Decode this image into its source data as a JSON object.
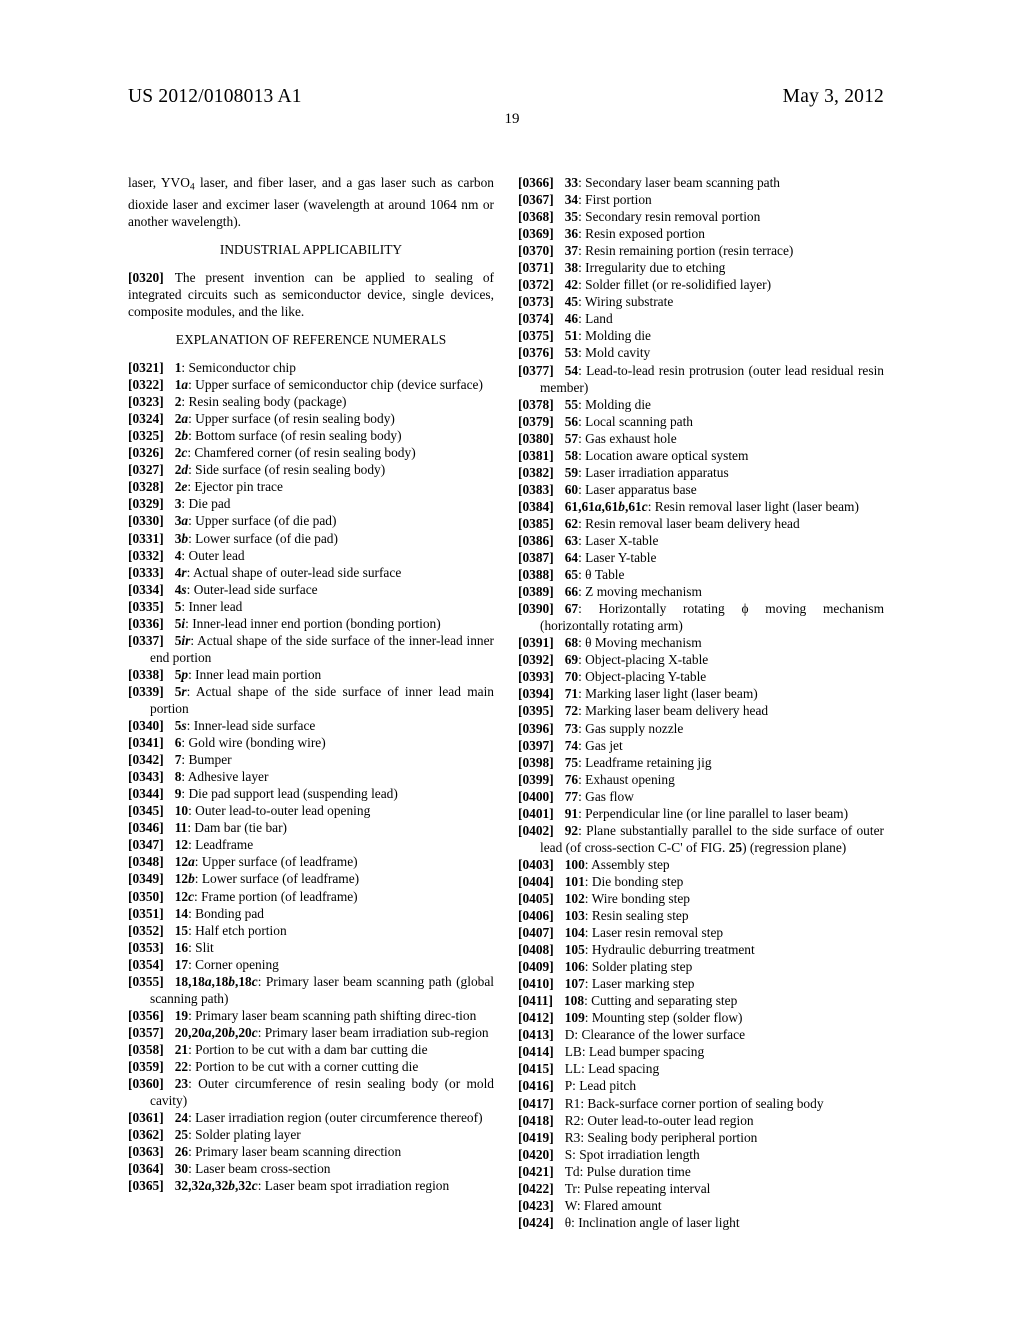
{
  "header": {
    "pub_number": "US 2012/0108013 A1",
    "pub_date": "May 3, 2012",
    "page_number": "19"
  },
  "left_column": {
    "continuation_paragraph": "laser, YVO4 laser, and fiber laser, and a gas laser such as carbon dioxide laser and excimer laser (wavelength at around 1064 nm or another wavelength).",
    "heading_industrial": "INDUSTRIAL APPLICABILITY",
    "para_0320_num": "[0320]",
    "para_0320_text": "The present invention can be applied to sealing of integrated circuits such as semiconductor device, single devices, composite modules, and the like.",
    "heading_explanation": "EXPLANATION OF REFERENCE NUMERALS",
    "entries": [
      {
        "num": "[0321]",
        "label": "1",
        "label_italic": "",
        "text": ": Semiconductor chip"
      },
      {
        "num": "[0322]",
        "label": "1",
        "label_italic": "a",
        "text": ": Upper surface of semiconductor chip (device surface)"
      },
      {
        "num": "[0323]",
        "label": "2",
        "label_italic": "",
        "text": ": Resin sealing body (package)"
      },
      {
        "num": "[0324]",
        "label": "2",
        "label_italic": "a",
        "text": ": Upper surface (of resin sealing body)"
      },
      {
        "num": "[0325]",
        "label": "2",
        "label_italic": "b",
        "text": ": Bottom surface (of resin sealing body)"
      },
      {
        "num": "[0326]",
        "label": "2",
        "label_italic": "c",
        "text": ": Chamfered corner (of resin sealing body)"
      },
      {
        "num": "[0327]",
        "label": "2",
        "label_italic": "d",
        "text": ": Side surface (of resin sealing body)"
      },
      {
        "num": "[0328]",
        "label": "2",
        "label_italic": "e",
        "text": ": Ejector pin trace"
      },
      {
        "num": "[0329]",
        "label": "3",
        "label_italic": "",
        "text": ": Die pad"
      },
      {
        "num": "[0330]",
        "label": "3",
        "label_italic": "a",
        "text": ": Upper surface (of die pad)"
      },
      {
        "num": "[0331]",
        "label": "3",
        "label_italic": "b",
        "text": ": Lower surface (of die pad)"
      },
      {
        "num": "[0332]",
        "label": "4",
        "label_italic": "",
        "text": ": Outer lead"
      },
      {
        "num": "[0333]",
        "label": "4",
        "label_italic": "r",
        "text": ": Actual shape of outer-lead side surface"
      },
      {
        "num": "[0334]",
        "label": "4",
        "label_italic": "s",
        "text": ": Outer-lead side surface"
      },
      {
        "num": "[0335]",
        "label": "5",
        "label_italic": "",
        "text": ": Inner lead"
      },
      {
        "num": "[0336]",
        "label": "5",
        "label_italic": "i",
        "text": ": Inner-lead inner end portion (bonding portion)"
      },
      {
        "num": "[0337]",
        "label": "5",
        "label_italic": "ir",
        "text": ": Actual shape of the side surface of the inner-lead inner end portion"
      },
      {
        "num": "[0338]",
        "label": "5",
        "label_italic": "p",
        "text": ": Inner lead main portion"
      },
      {
        "num": "[0339]",
        "label": "5",
        "label_italic": "r",
        "text": ": Actual shape of the side surface of inner lead main portion"
      },
      {
        "num": "[0340]",
        "label": "5",
        "label_italic": "s",
        "text": ": Inner-lead side surface"
      },
      {
        "num": "[0341]",
        "label": "6",
        "label_italic": "",
        "text": ": Gold wire (bonding wire)"
      },
      {
        "num": "[0342]",
        "label": "7",
        "label_italic": "",
        "text": ": Bumper"
      },
      {
        "num": "[0343]",
        "label": "8",
        "label_italic": "",
        "text": ": Adhesive layer"
      },
      {
        "num": "[0344]",
        "label": "9",
        "label_italic": "",
        "text": ": Die pad support lead (suspending lead)"
      },
      {
        "num": "[0345]",
        "label": "10",
        "label_italic": "",
        "text": ": Outer lead-to-outer lead opening"
      },
      {
        "num": "[0346]",
        "label": "11",
        "label_italic": "",
        "text": ": Dam bar (tie bar)"
      },
      {
        "num": "[0347]",
        "label": "12",
        "label_italic": "",
        "text": ": Leadframe"
      },
      {
        "num": "[0348]",
        "label": "12",
        "label_italic": "a",
        "text": ": Upper surface (of leadframe)"
      },
      {
        "num": "[0349]",
        "label": "12",
        "label_italic": "b",
        "text": ": Lower surface (of leadframe)"
      },
      {
        "num": "[0350]",
        "label": "12",
        "label_italic": "c",
        "text": ": Frame portion (of leadframe)"
      },
      {
        "num": "[0351]",
        "label": "14",
        "label_italic": "",
        "text": ": Bonding pad"
      },
      {
        "num": "[0352]",
        "label": "15",
        "label_italic": "",
        "text": ": Half etch portion"
      },
      {
        "num": "[0353]",
        "label": "16",
        "label_italic": "",
        "text": ": Slit"
      },
      {
        "num": "[0354]",
        "label": "17",
        "label_italic": "",
        "text": ": Corner opening"
      },
      {
        "num": "[0355]",
        "label_multi": "18,18a,18b,18c",
        "text": ": Primary laser beam scanning path (global scanning path)"
      },
      {
        "num": "[0356]",
        "label": "19",
        "label_italic": "",
        "text": ": Primary laser beam scanning path shifting direc-tion"
      },
      {
        "num": "[0357]",
        "label_multi": "20,20a,20b,20c",
        "text": ": Primary laser beam irradiation sub-region"
      },
      {
        "num": "[0358]",
        "label": "21",
        "label_italic": "",
        "text": ": Portion to be cut with a dam bar cutting die"
      },
      {
        "num": "[0359]",
        "label": "22",
        "label_italic": "",
        "text": ": Portion to be cut with a corner cutting die"
      },
      {
        "num": "[0360]",
        "label": "23",
        "label_italic": "",
        "text": ": Outer circumference of resin sealing body (or mold cavity)"
      },
      {
        "num": "[0361]",
        "label": "24",
        "label_italic": "",
        "text": ": Laser irradiation region (outer circumference thereof)"
      },
      {
        "num": "[0362]",
        "label": "25",
        "label_italic": "",
        "text": ": Solder plating layer"
      },
      {
        "num": "[0363]",
        "label": "26",
        "label_italic": "",
        "text": ": Primary laser beam scanning direction"
      },
      {
        "num": "[0364]",
        "label": "30",
        "label_italic": "",
        "text": ": Laser beam cross-section"
      },
      {
        "num": "[0365]",
        "label_multi": "32,32a,32b,32c",
        "text": ": Laser beam spot irradiation region"
      }
    ]
  },
  "right_column": {
    "entries": [
      {
        "num": "[0366]",
        "label": "33",
        "label_italic": "",
        "text": ": Secondary laser beam scanning path"
      },
      {
        "num": "[0367]",
        "label": "34",
        "label_italic": "",
        "text": ": First portion"
      },
      {
        "num": "[0368]",
        "label": "35",
        "label_italic": "",
        "text": ": Secondary resin removal portion"
      },
      {
        "num": "[0369]",
        "label": "36",
        "label_italic": "",
        "text": ": Resin exposed portion"
      },
      {
        "num": "[0370]",
        "label": "37",
        "label_italic": "",
        "text": ": Resin remaining portion (resin terrace)"
      },
      {
        "num": "[0371]",
        "label": "38",
        "label_italic": "",
        "text": ": Irregularity due to etching"
      },
      {
        "num": "[0372]",
        "label": "42",
        "label_italic": "",
        "text": ": Solder fillet (or re-solidified layer)"
      },
      {
        "num": "[0373]",
        "label": "45",
        "label_italic": "",
        "text": ": Wiring substrate"
      },
      {
        "num": "[0374]",
        "label": "46",
        "label_italic": "",
        "text": ": Land"
      },
      {
        "num": "[0375]",
        "label": "51",
        "label_italic": "",
        "text": ": Molding die"
      },
      {
        "num": "[0376]",
        "label": "53",
        "label_italic": "",
        "text": ": Mold cavity"
      },
      {
        "num": "[0377]",
        "label": "54",
        "label_italic": "",
        "text": ": Lead-to-lead resin protrusion (outer lead residual resin member)"
      },
      {
        "num": "[0378]",
        "label": "55",
        "label_italic": "",
        "text": ": Molding die"
      },
      {
        "num": "[0379]",
        "label": "56",
        "label_italic": "",
        "text": ": Local scanning path"
      },
      {
        "num": "[0380]",
        "label": "57",
        "label_italic": "",
        "text": ": Gas exhaust hole"
      },
      {
        "num": "[0381]",
        "label": "58",
        "label_italic": "",
        "text": ": Location aware optical system"
      },
      {
        "num": "[0382]",
        "label": "59",
        "label_italic": "",
        "text": ": Laser irradiation apparatus"
      },
      {
        "num": "[0383]",
        "label": "60",
        "label_italic": "",
        "text": ": Laser apparatus base"
      },
      {
        "num": "[0384]",
        "label_multi": "61,61a,61b,61c",
        "text": ": Resin removal laser light (laser beam)"
      },
      {
        "num": "[0385]",
        "label": "62",
        "label_italic": "",
        "text": ": Resin removal laser beam delivery head"
      },
      {
        "num": "[0386]",
        "label": "63",
        "label_italic": "",
        "text": ": Laser X-table"
      },
      {
        "num": "[0387]",
        "label": "64",
        "label_italic": "",
        "text": ": Laser Y-table"
      },
      {
        "num": "[0388]",
        "label": "65",
        "label_italic": "",
        "text": ": θ Table"
      },
      {
        "num": "[0389]",
        "label": "66",
        "label_italic": "",
        "text": ": Z moving mechanism"
      },
      {
        "num": "[0390]",
        "label": "67",
        "label_italic": "",
        "text": ": Horizontally rotating ϕ moving mechanism (horizontally rotating arm)"
      },
      {
        "num": "[0391]",
        "label": "68",
        "label_italic": "",
        "text": ": θ Moving mechanism"
      },
      {
        "num": "[0392]",
        "label": "69",
        "label_italic": "",
        "text": ": Object-placing X-table"
      },
      {
        "num": "[0393]",
        "label": "70",
        "label_italic": "",
        "text": ": Object-placing Y-table"
      },
      {
        "num": "[0394]",
        "label": "71",
        "label_italic": "",
        "text": ": Marking laser light (laser beam)"
      },
      {
        "num": "[0395]",
        "label": "72",
        "label_italic": "",
        "text": ": Marking laser beam delivery head"
      },
      {
        "num": "[0396]",
        "label": "73",
        "label_italic": "",
        "text": ": Gas supply nozzle"
      },
      {
        "num": "[0397]",
        "label": "74",
        "label_italic": "",
        "text": ": Gas jet"
      },
      {
        "num": "[0398]",
        "label": "75",
        "label_italic": "",
        "text": ": Leadframe retaining jig"
      },
      {
        "num": "[0399]",
        "label": "76",
        "label_italic": "",
        "text": ": Exhaust opening"
      },
      {
        "num": "[0400]",
        "label": "77",
        "label_italic": "",
        "text": ": Gas flow"
      },
      {
        "num": "[0401]",
        "label": "91",
        "label_italic": "",
        "text": ": Perpendicular line (or line parallel to laser beam)"
      },
      {
        "num": "[0402]",
        "label": "92",
        "label_italic": "",
        "text": ": Plane substantially parallel to the side surface of outer lead (of cross-section C-C' of FIG. 25) (regression plane)",
        "bold_tail": "25"
      },
      {
        "num": "[0403]",
        "label": "100",
        "label_italic": "",
        "text": ": Assembly step"
      },
      {
        "num": "[0404]",
        "label": "101",
        "label_italic": "",
        "text": ": Die bonding step"
      },
      {
        "num": "[0405]",
        "label": "102",
        "label_italic": "",
        "text": ": Wire bonding step"
      },
      {
        "num": "[0406]",
        "label": "103",
        "label_italic": "",
        "text": ": Resin sealing step"
      },
      {
        "num": "[0407]",
        "label": "104",
        "label_italic": "",
        "text": ": Laser resin removal step"
      },
      {
        "num": "[0408]",
        "label": "105",
        "label_italic": "",
        "text": ": Hydraulic deburring treatment"
      },
      {
        "num": "[0409]",
        "label": "106",
        "label_italic": "",
        "text": ": Solder plating step"
      },
      {
        "num": "[0410]",
        "label": "107",
        "label_italic": "",
        "text": ": Laser marking step"
      },
      {
        "num": "[0411]",
        "label": "108",
        "label_italic": "",
        "text": ": Cutting and separating step"
      },
      {
        "num": "[0412]",
        "label": "109",
        "label_italic": "",
        "text": ": Mounting step (solder flow)"
      },
      {
        "num": "[0413]",
        "label_plain": "D",
        "text": ": Clearance of the lower surface"
      },
      {
        "num": "[0414]",
        "label_plain": "LB",
        "text": ": Lead bumper spacing"
      },
      {
        "num": "[0415]",
        "label_plain": "LL",
        "text": ": Lead spacing"
      },
      {
        "num": "[0416]",
        "label_plain": "P",
        "text": ": Lead pitch"
      },
      {
        "num": "[0417]",
        "label_plain": "R1",
        "text": ": Back-surface corner portion of sealing body"
      },
      {
        "num": "[0418]",
        "label_plain": "R2",
        "text": ": Outer lead-to-outer lead region"
      },
      {
        "num": "[0419]",
        "label_plain": "R3",
        "text": ": Sealing body peripheral portion"
      },
      {
        "num": "[0420]",
        "label_plain": "S",
        "text": ": Spot irradiation length"
      },
      {
        "num": "[0421]",
        "label_plain": "Td",
        "text": ": Pulse duration time"
      },
      {
        "num": "[0422]",
        "label_plain": "Tr",
        "text": ": Pulse repeating interval"
      },
      {
        "num": "[0423]",
        "label_plain": "W",
        "text": ": Flared amount"
      },
      {
        "num": "[0424]",
        "label_plain": "θ",
        "text": ": Inclination angle of laser light"
      }
    ]
  }
}
